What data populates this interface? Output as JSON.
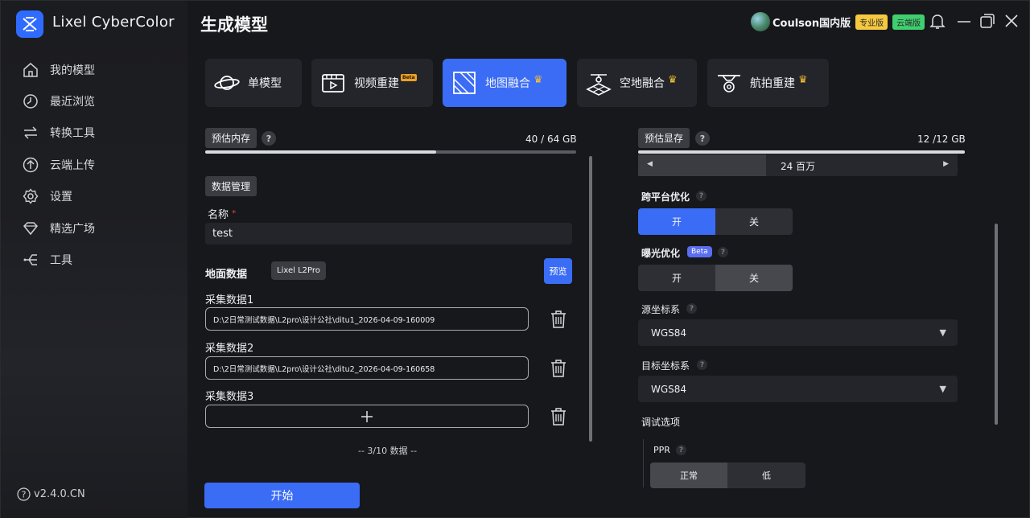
{
  "app": {
    "name": "Lixel CyberColor",
    "version": "v2.4.0.CN"
  },
  "sidebar": {
    "items": [
      {
        "label": "我的模型",
        "icon": "home-icon"
      },
      {
        "label": "最近浏览",
        "icon": "clock-icon"
      },
      {
        "label": "转换工具",
        "icon": "transfer-icon"
      },
      {
        "label": "云端上传",
        "icon": "upload-icon"
      },
      {
        "label": "设置",
        "icon": "gear-icon"
      },
      {
        "label": "精选广场",
        "icon": "diamond-icon"
      },
      {
        "label": "工具",
        "icon": "tools-icon"
      }
    ]
  },
  "header": {
    "title": "生成模型",
    "user_name": "Coulson国内版",
    "badge_pro": "专业版",
    "badge_cloud": "云端版"
  },
  "modes": [
    {
      "label": "单模型",
      "icon": "planet-icon",
      "beta": "",
      "crown": false,
      "active": false
    },
    {
      "label": "视频重建",
      "icon": "video-icon",
      "beta": "Beta",
      "crown": false,
      "active": false
    },
    {
      "label": "地图融合",
      "icon": "map-fusion-icon",
      "beta": "",
      "crown": true,
      "active": true
    },
    {
      "label": "空地融合",
      "icon": "air-ground-icon",
      "beta": "",
      "crown": true,
      "active": false
    },
    {
      "label": "航拍重建",
      "icon": "drone-icon",
      "beta": "",
      "crown": true,
      "active": false
    }
  ],
  "left": {
    "memory_label": "预估内存",
    "memory_value": "40 / 64 GB",
    "memory_fraction": 0.623,
    "data_mgmt": "数据管理",
    "name_label": "名称",
    "required_mark": "*",
    "name_value": "test",
    "ground_data_label": "地面数据",
    "device_chip": "Lixel L2Pro",
    "preview_button": "预览",
    "collections": [
      {
        "label": "采集数据1",
        "path": "D:\\2日常测试数据\\L2pro\\设计公社\\ditu1_2026-04-09-160009"
      },
      {
        "label": "采集数据2",
        "path": "D:\\2日常测试数据\\L2pro\\设计公社\\ditu2_2026-04-09-160658"
      },
      {
        "label": "采集数据3",
        "path": ""
      }
    ],
    "count_text": "-- 3/10 数据 --",
    "start_button": "开始"
  },
  "right": {
    "vram_label": "预估显存",
    "vram_value": "12 /12 GB",
    "vram_fraction": 1.0,
    "stepper_value": "24 百万",
    "stepper_fraction": 0.4,
    "cross_platform_label": "跨平台优化",
    "on": "开",
    "off": "关",
    "exposure_label": "曝光优化",
    "exposure_beta": "Beta",
    "src_crs_label": "源坐标系",
    "src_crs_value": "WGS84",
    "dst_crs_label": "目标坐标系",
    "dst_crs_value": "WGS84",
    "debug_label": "调试选项",
    "ppr_label": "PPR",
    "ppr_normal": "正常",
    "ppr_low": "低"
  },
  "colors": {
    "accent": "#3b6cf6",
    "pro_badge": "#f5c840",
    "cloud_badge": "#3fcf6e",
    "crown": "#f5c030"
  }
}
